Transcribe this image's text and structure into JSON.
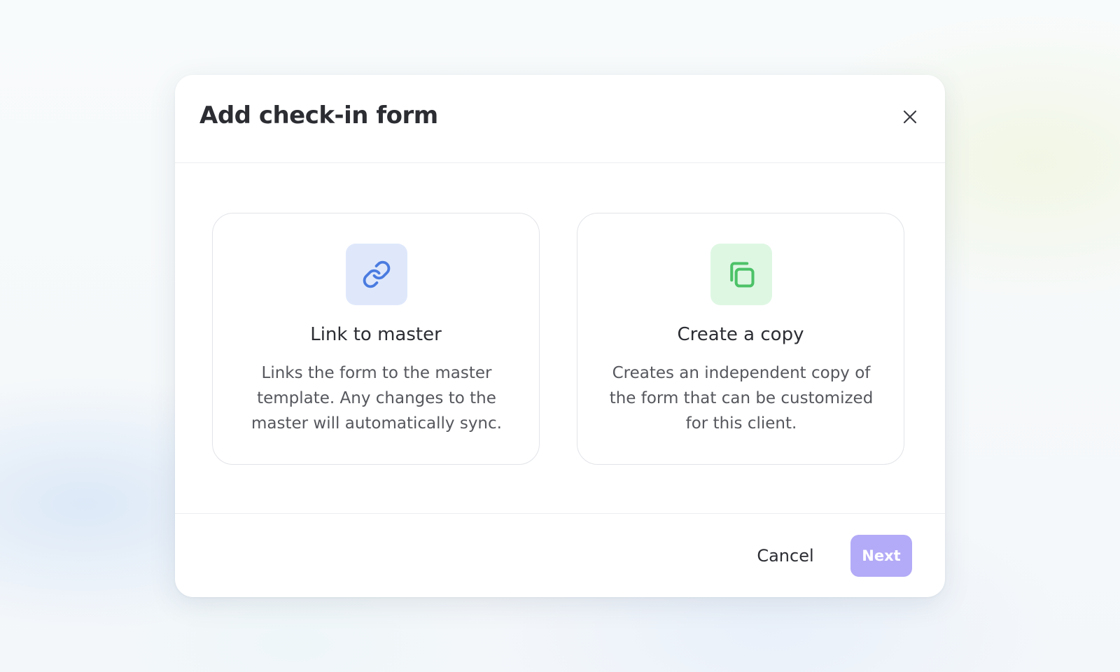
{
  "dialog": {
    "title": "Add check-in form",
    "close_icon": "close-icon"
  },
  "options": [
    {
      "icon": "link-icon",
      "icon_color": "#4a7be0",
      "icon_bg": "#dfe8fb",
      "title": "Link to master",
      "description": "Links the form to the master template. Any changes to the master will automatically sync."
    },
    {
      "icon": "copy-icon",
      "icon_color": "#4cc267",
      "icon_bg": "#def7e3",
      "title": "Create a copy",
      "description": "Creates an independent copy of the form that can be customized for this client."
    }
  ],
  "footer": {
    "cancel_label": "Cancel",
    "next_label": "Next",
    "next_disabled": true,
    "next_color": "#b3abf7"
  }
}
